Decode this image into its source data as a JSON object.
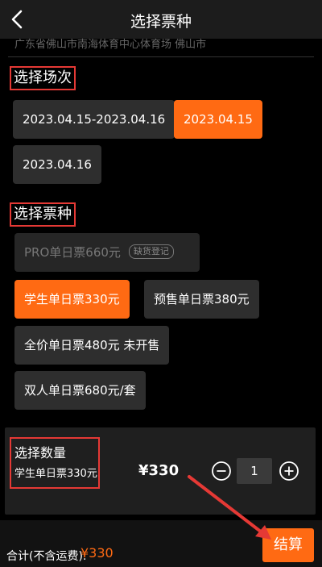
{
  "header": {
    "title": "选择票种"
  },
  "venue_subtitle": "广东省佛山市南海体育中心体育场 佛山市",
  "sessions": {
    "title": "选择场次",
    "options": [
      {
        "label": "2023.04.15-2023.04.16",
        "state": "normal"
      },
      {
        "label": "2023.04.15",
        "state": "selected"
      },
      {
        "label": "2023.04.16",
        "state": "normal"
      }
    ]
  },
  "tickets": {
    "title": "选择票种",
    "options": [
      {
        "label": "PRO单日票660元",
        "tag": "缺货登记",
        "state": "disabled"
      },
      {
        "label": "学生单日票330元",
        "state": "selected"
      },
      {
        "label": "预售单日票380元",
        "state": "normal"
      },
      {
        "label": "全价单日票480元 未开售",
        "state": "normal"
      },
      {
        "label": "双人单日票680元/套",
        "state": "normal"
      }
    ]
  },
  "quantity": {
    "title": "选择数量",
    "ticket_name": "学生单日票330元",
    "price": "¥330",
    "value": "1"
  },
  "footer": {
    "total_label": "合计(不含运费):",
    "total_value": "¥330",
    "checkout_label": "结算"
  },
  "colors": {
    "accent": "#ff6a13",
    "highlight_box": "#e53935",
    "background": "#000000"
  },
  "icons": [
    "back-icon",
    "minus-icon",
    "plus-icon"
  ]
}
